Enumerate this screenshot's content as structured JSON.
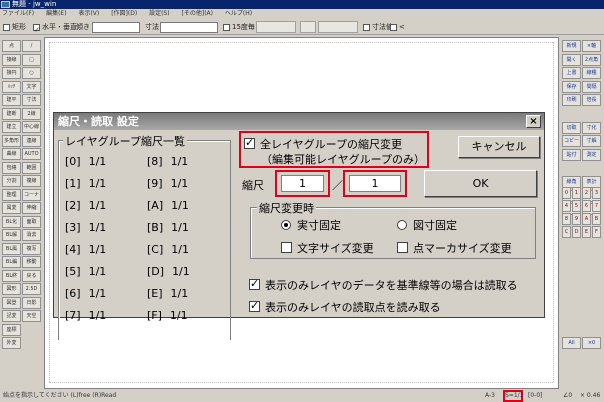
{
  "window": {
    "title": "無題 - jw_win"
  },
  "menu": [
    "ファイル(F)",
    "編集(E)",
    "表示(V)",
    "[作図](D)",
    "設定(S)",
    "[その他](A)",
    "ヘルプ(H)"
  ],
  "toolbar": {
    "rect_label": "矩形",
    "horizvert_label": "水平・垂直",
    "tilt_label": "傾き",
    "dimension_label": "寸法",
    "deg15_label": "15度毎",
    "dimval_label": "寸法値"
  },
  "left_tools": [
    "点",
    "接線",
    "接円",
    "ﾊｯﾁ",
    "建平",
    "建断",
    "建立",
    "多角形",
    "曲線",
    "包絡",
    "分割",
    "整理",
    "属変",
    "BL化",
    "BL解",
    "BL属",
    "BL編",
    "BL終",
    "図形",
    "図登",
    "記変",
    "座標",
    "外変",
    "/",
    "□",
    "○",
    "文字",
    "寸法",
    "2線",
    "中心線",
    "連線",
    "AUTO",
    "範囲",
    "複線",
    "コーナー",
    "伸縮",
    "面取",
    "消去",
    "複写",
    "移動",
    "戻る",
    "2.5D",
    "日影",
    "天空"
  ],
  "right_tools": [
    "新規",
    "開く",
    "上書",
    "保存",
    "印刷",
    "切取",
    "コピー",
    "貼付",
    "線角",
    "線長",
    "鉛直",
    "×軸",
    "2点角",
    "線種",
    "間隔",
    "倍長",
    "寸化",
    "寸解",
    "測定",
    "表計",
    "式計",
    "ﾊﾟﾗﾒ",
    "All",
    "×0"
  ],
  "layer_digits": [
    "0",
    "1",
    "2",
    "3",
    "4",
    "5",
    "6",
    "7",
    "8",
    "9",
    "A",
    "B",
    "C",
    "D",
    "E",
    "F"
  ],
  "status": {
    "message": "始点を指示してください (L)free (R)Read",
    "paper": "A-3",
    "scale": "S=1/1",
    "group": "[0-0]",
    "angle": "∠0",
    "zoom": "× 0.46"
  },
  "dialog": {
    "title": "縮尺・読取  設定",
    "close": "×",
    "layer_group_list_label": "レイヤグループ縮尺一覧",
    "layer_groups": [
      {
        "id": "[0]",
        "scale": "1/1"
      },
      {
        "id": "[8]",
        "scale": "1/1"
      },
      {
        "id": "[1]",
        "scale": "1/1"
      },
      {
        "id": "[9]",
        "scale": "1/1"
      },
      {
        "id": "[2]",
        "scale": "1/1"
      },
      {
        "id": "[A]",
        "scale": "1/1"
      },
      {
        "id": "[3]",
        "scale": "1/1"
      },
      {
        "id": "[B]",
        "scale": "1/1"
      },
      {
        "id": "[4]",
        "scale": "1/1"
      },
      {
        "id": "[C]",
        "scale": "1/1"
      },
      {
        "id": "[5]",
        "scale": "1/1"
      },
      {
        "id": "[D]",
        "scale": "1/1"
      },
      {
        "id": "[6]",
        "scale": "1/1"
      },
      {
        "id": "[E]",
        "scale": "1/1"
      },
      {
        "id": "[7]",
        "scale": "1/1"
      },
      {
        "id": "[F]",
        "scale": "1/1"
      }
    ],
    "all_groups_line1": "全レイヤグループの縮尺変更",
    "all_groups_line2": "（編集可能レイヤグループのみ）",
    "cancel": "キャンセル",
    "scale_label": "縮尺",
    "scale_numerator": "1",
    "scale_separator": "／",
    "scale_denominator": "1",
    "ok": "OK",
    "change_group_label": "縮尺変更時",
    "radio_actual": "実寸固定",
    "radio_drawing": "図寸固定",
    "text_size_change": "文字サイズ変更",
    "point_marker_change": "点マーカサイズ変更",
    "read_display_only": "表示のみレイヤのデータを基準線等の場合は読取る",
    "read_points": "表示のみレイヤの読取点を読み取る"
  }
}
